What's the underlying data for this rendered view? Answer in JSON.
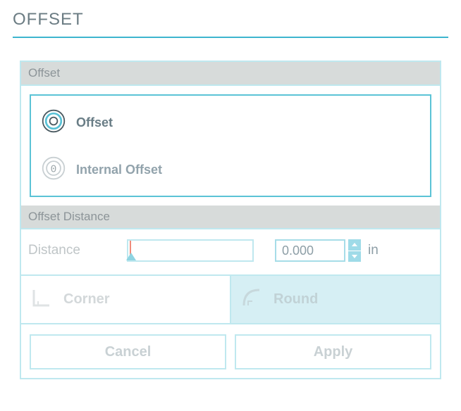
{
  "title": "OFFSET",
  "sections": {
    "type": {
      "header": "Offset",
      "items": [
        {
          "label": "Offset",
          "selected": true
        },
        {
          "label": "Internal Offset",
          "selected": false
        }
      ]
    },
    "distance": {
      "header": "Offset Distance",
      "label": "Distance",
      "value": "0.000",
      "unit": "in"
    }
  },
  "corners": {
    "corner": "Corner",
    "round": "Round",
    "active": "round"
  },
  "actions": {
    "cancel": "Cancel",
    "apply": "Apply"
  }
}
